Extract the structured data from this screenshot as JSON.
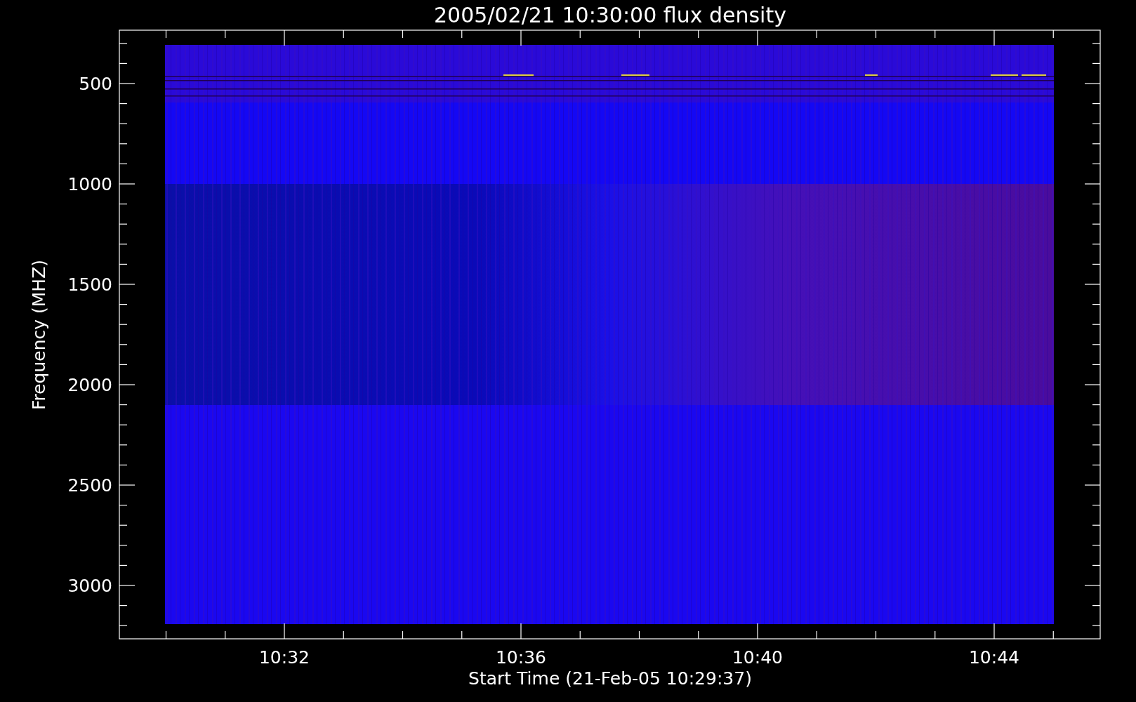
{
  "plot": {
    "title": "2005/02/21 10:30:00 flux density",
    "ylabel": "Frequency (MHZ)",
    "xlabel": "Start Time (21-Feb-05 10:29:37)",
    "yticks": [
      "500",
      "1000",
      "1500",
      "2000",
      "2500",
      "3000"
    ],
    "xticks": [
      "10:32",
      "10:36",
      "10:40",
      "10:44"
    ]
  }
}
